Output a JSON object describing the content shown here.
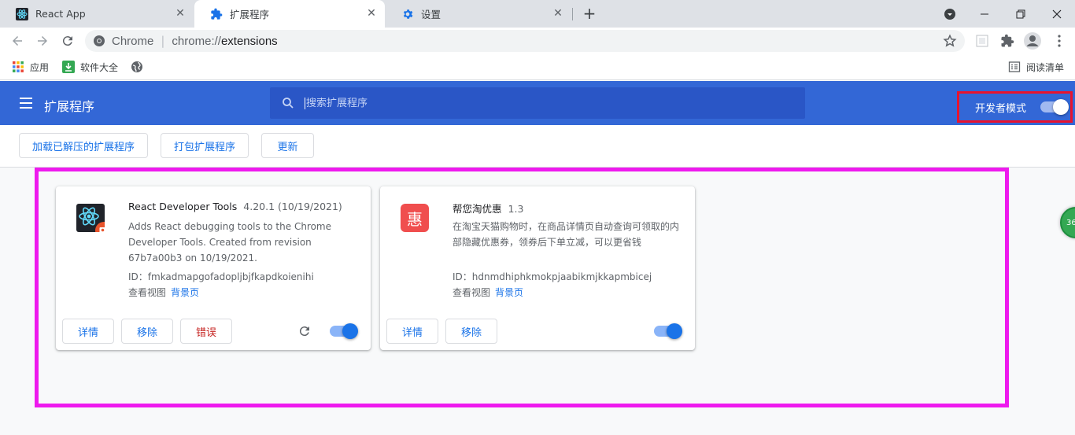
{
  "tabs": [
    {
      "title": "React App",
      "icon": "react-icon",
      "active": false
    },
    {
      "title": "扩展程序",
      "icon": "puzzle-icon",
      "active": true
    },
    {
      "title": "设置",
      "icon": "gear-icon",
      "active": false
    }
  ],
  "address_bar": {
    "scheme_label": "Chrome",
    "url_scheme": "chrome://",
    "url_path": "extensions"
  },
  "bookmarks": [
    {
      "label": "应用",
      "icon": "apps-grid-icon"
    },
    {
      "label": "软件大全",
      "icon": "download-icon"
    },
    {
      "label": "",
      "icon": "globe-icon"
    }
  ],
  "reading_list": "阅读清单",
  "header": {
    "title": "扩展程序",
    "search_placeholder": "搜索扩展程序",
    "dev_mode_label": "开发者模式",
    "dev_mode_on": true
  },
  "actions": {
    "load_unpacked": "加载已解压的扩展程序",
    "pack": "打包扩展程序",
    "update": "更新"
  },
  "extensions": [
    {
      "name": "React Developer Tools",
      "version": "4.20.1 (10/19/2021)",
      "description": "Adds React debugging tools to the Chrome Developer Tools. Created from revision 67b7a00b3 on 10/19/2021.",
      "id_line": "ID：fmkadmapgofadopljbjfkapdkoienihi",
      "views_label": "查看视图",
      "views_link": "背景页",
      "details": "详情",
      "remove": "移除",
      "errors": "错误",
      "enabled": true,
      "icon": "react-devtools-icon"
    },
    {
      "name": "帮您淘优惠",
      "version": "1.3",
      "description": "在淘宝天猫购物时，在商品详情页自动查询可领取的内部隐藏优惠券，领券后下单立减，可以更省钱",
      "id_line": "ID：hdnmdhiphkmokpjaabikmjkkapmbicej",
      "views_label": "查看视图",
      "views_link": "背景页",
      "details": "详情",
      "remove": "移除",
      "enabled": true,
      "logo_char": "惠",
      "icon": "coupon-icon"
    }
  ],
  "edge_badge": "36",
  "colors": {
    "header_blue": "#3367d6",
    "search_blue": "#2a56c6",
    "highlight_red": "#e8132e",
    "highlight_magenta": "#ee1aee",
    "link_blue": "#1a73e8"
  }
}
